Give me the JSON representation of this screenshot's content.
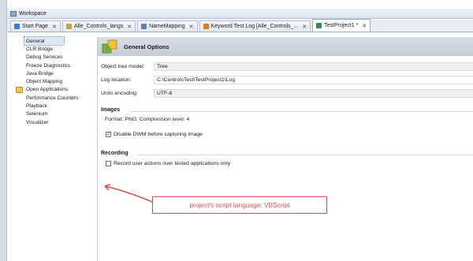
{
  "workspace": {
    "title": "Workspace"
  },
  "tabs": [
    {
      "label": "Start Page",
      "icon": "start-page-icon",
      "color": "#3c7dd1"
    },
    {
      "label": "Alle_Controls_langs",
      "icon": "project-icon",
      "color": "#c8a24a"
    },
    {
      "label": "NameMapping",
      "icon": "namemapping-icon",
      "color": "#5b7fb0"
    },
    {
      "label": "Keyword Test Log [Alle_Controls_...",
      "icon": "keyword-log-icon",
      "color": "#e0772a"
    },
    {
      "label": "TestProject1 *",
      "icon": "project-settings-icon",
      "color": "#2f8a5b",
      "active": true
    }
  ],
  "tree": {
    "items": [
      {
        "label": "General",
        "selected": true
      },
      {
        "label": "CLR Bridge"
      },
      {
        "label": "Debug Services"
      },
      {
        "label": "Freeze Diagnostics"
      },
      {
        "label": "Java Bridge"
      },
      {
        "label": "Object Mapping"
      },
      {
        "label": "Open Applications",
        "expander": true
      },
      {
        "label": "Performance Counters"
      },
      {
        "label": "Playback"
      },
      {
        "label": "Selenium"
      },
      {
        "label": "Visualizer"
      }
    ]
  },
  "panel": {
    "title": "General Options",
    "fields": [
      {
        "label": "Object tree model:",
        "value": "Tree"
      },
      {
        "label": "Log location:",
        "value": "C:\\ControlsTest\\TestProject1\\Log"
      },
      {
        "label": "Units encoding:",
        "value": "UTF-8"
      }
    ],
    "images": {
      "section": "Images",
      "format_text": "Format: PNG; Compression level: 4",
      "checkbox_label": "Disable DWM before capturing image",
      "checked": true
    },
    "recording": {
      "section": "Recording",
      "checkbox_label": "Record user actions over tested applications only",
      "checked": false
    }
  },
  "annotation": {
    "text": "project's script language: VBScript",
    "color": "#d9534f"
  }
}
